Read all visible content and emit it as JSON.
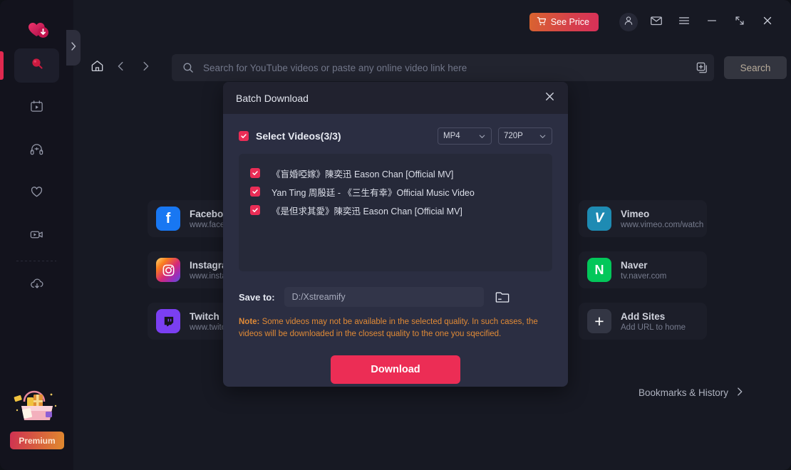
{
  "sidebar": {
    "logo_name": "app-logo",
    "items": [
      {
        "name": "search",
        "icon": "magnifier-icon",
        "active": true
      },
      {
        "name": "video-library",
        "icon": "video-board-icon",
        "active": false
      },
      {
        "name": "audio",
        "icon": "headphones-icon",
        "active": false
      },
      {
        "name": "favorites",
        "icon": "heart-icon",
        "active": false
      },
      {
        "name": "recorder",
        "icon": "video-camera-icon",
        "active": false
      },
      {
        "name": "downloads",
        "icon": "cloud-download-icon",
        "active": false
      }
    ],
    "premium_label": "Premium"
  },
  "titlebar": {
    "see_price_label": "See Price",
    "see_price_icon": "cart-icon",
    "account_icon": "user-icon",
    "mail_icon": "envelope-icon",
    "menu_icon": "hamburger-icon",
    "minimize_icon": "minimize-icon",
    "maximize_icon": "expand-icon",
    "close_icon": "close-icon"
  },
  "search": {
    "home_icon": "home-icon",
    "back_icon": "chevron-left-icon",
    "forward_icon": "chevron-right-icon",
    "search_icon": "search-icon",
    "placeholder": "Search for YouTube videos or paste any online video link here",
    "value": "",
    "paste_icon": "paste-icon",
    "button_label": "Search"
  },
  "site_cards_left": [
    {
      "title": "Facebook",
      "url": "www.facebook.com",
      "letter": "f",
      "color": "#1877F2"
    },
    {
      "title": "Instagram",
      "url": "www.instagram.com",
      "letter": "",
      "color": "#C13584"
    },
    {
      "title": "Twitch",
      "url": "www.twitch.tv",
      "letter": "",
      "color": "#7B3FF2"
    }
  ],
  "site_cards_right": [
    {
      "title": "Vimeo",
      "url": "www.vimeo.com/watch",
      "letter": "V",
      "color": "#1E8BB3"
    },
    {
      "title": "Naver",
      "url": "tv.naver.com",
      "letter": "N",
      "color": "#03C75A"
    },
    {
      "title": "Add Sites",
      "url": "Add URL to home",
      "letter": "+",
      "color": "#333644"
    }
  ],
  "bookmarks": {
    "label": "Bookmarks & History",
    "chevron_icon": "chevron-right-icon"
  },
  "modal": {
    "title": "Batch Download",
    "close_icon": "close-icon",
    "select_all_label": "Select Videos(3/3)",
    "select_all_checked": true,
    "format_dropdown": {
      "value": "MP4",
      "chevron_icon": "chevron-down-icon"
    },
    "quality_dropdown": {
      "value": "720P",
      "chevron_icon": "chevron-down-icon"
    },
    "videos": [
      {
        "label": "《盲婚啞嫁》陳奕迅 Eason Chan [Official MV]",
        "checked": true
      },
      {
        "label": "Yan Ting 周殷廷 - 《三生有幸》Official Music Video",
        "checked": true
      },
      {
        "label": "《是但求其愛》陳奕迅 Eason Chan [Official MV]",
        "checked": true
      }
    ],
    "saveto_label": "Save to:",
    "saveto_value": "D:/Xstreamify",
    "saveto_placeholder": "D:/Xstreamify",
    "folder_icon": "folder-icon",
    "note_prefix": "Note:",
    "note_text": "Some videos may not be available in the selected quality. In such cases, the videos will be downloaded in the closest quality to the one you sqecified.",
    "download_label": "Download"
  },
  "colors": {
    "accent_pink": "#ec2d55",
    "note_orange": "#e08a36",
    "modal_bg": "#2b2e42",
    "app_bg": "#171923"
  }
}
